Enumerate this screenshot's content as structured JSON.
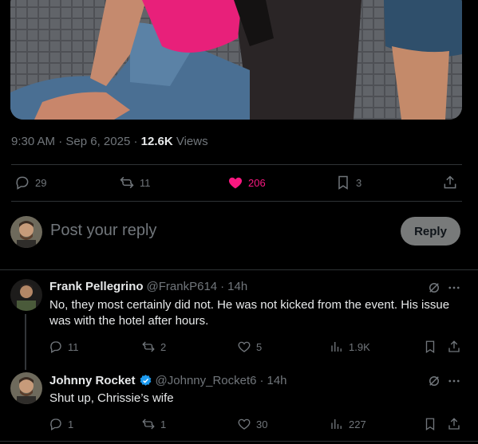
{
  "post": {
    "time": "9:30 AM",
    "sep1": " · ",
    "date": "Sep 6, 2025",
    "sep2": " · ",
    "views_count": "12.6K",
    "views_label": " Views",
    "replies": "29",
    "reposts": "11",
    "likes": "206",
    "bookmarks": "3"
  },
  "composer": {
    "placeholder": "Post your reply",
    "reply_label": "Reply"
  },
  "replies": [
    {
      "name": "Frank Pellegrino",
      "handle": "@FrankP614",
      "sep": "·",
      "time": "14h",
      "text": "No, they most certainly did not. He was not kicked from the event. His issue was with the hotel after hours.",
      "replies": "11",
      "reposts": "2",
      "likes": "5",
      "views": "1.9K"
    },
    {
      "name": "Johnny Rocket",
      "handle": "@Johnny_Rocket6",
      "sep": "·",
      "time": "14h",
      "text": "Shut up, Chrissie’s wife",
      "replies": "1",
      "reposts": "1",
      "likes": "30",
      "views": "227"
    }
  ],
  "colors": {
    "background": "#000000",
    "text": "#e7e9ea",
    "secondary": "#71767b",
    "like_pink": "#f91880",
    "verified_blue": "#1d9bf0"
  },
  "icons": [
    "reply-icon",
    "repost-icon",
    "like-icon",
    "bookmark-icon",
    "share-icon",
    "grok-icon",
    "more-icon",
    "views-icon",
    "verified-badge-icon"
  ]
}
